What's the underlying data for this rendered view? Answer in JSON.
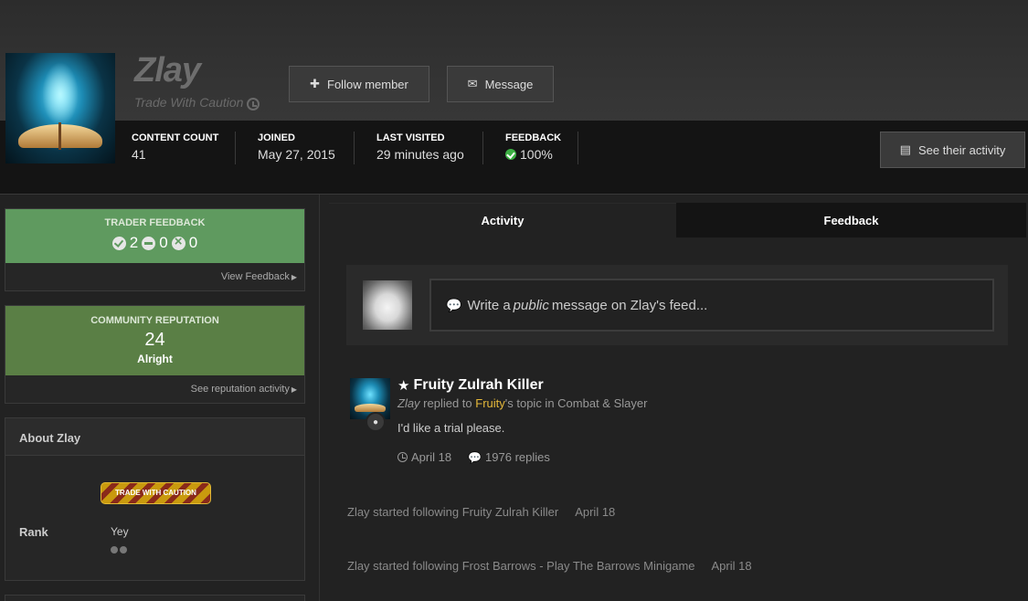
{
  "profile": {
    "username": "Zlay",
    "title": "Trade With Caution",
    "follow_label": "Follow member",
    "message_label": "Message",
    "activity_label": "See their activity",
    "stats": [
      {
        "label": "Content Count",
        "value": "41"
      },
      {
        "label": "Joined",
        "value": "May 27, 2015"
      },
      {
        "label": "Last Visited",
        "value": "29 minutes ago"
      },
      {
        "label": "Feedback",
        "value": "100%"
      }
    ]
  },
  "sidebar": {
    "trader_feedback": {
      "caption": "Trader Feedback",
      "positive": "2",
      "neutral": "0",
      "negative": "0",
      "link": "View Feedback"
    },
    "reputation": {
      "caption": "Community Reputation",
      "value": "24",
      "level": "Alright",
      "link": "See reputation activity"
    },
    "about": {
      "heading": "About Zlay",
      "badge_text": "TRADE WITH CAUTION",
      "rank_label": "Rank",
      "rank_value": "Yey"
    }
  },
  "tabs": [
    {
      "label": "Activity",
      "active": true
    },
    {
      "label": "Feedback",
      "active": false
    }
  ],
  "status": {
    "prefix": "Write a ",
    "emphasis": "public",
    "suffix": " message on Zlay's feed..."
  },
  "post": {
    "title": "Fruity Zulrah Killer",
    "author": "Zlay",
    "replied_text": " replied to ",
    "target_user": "Fruity",
    "topic_suffix": "'s topic in Combat & Slayer",
    "body": "I'd like a trial please.",
    "date": "April 18",
    "replies": "1976 replies"
  },
  "stream": [
    {
      "text": "Zlay started following Fruity Zulrah Killer",
      "date": "April 18"
    },
    {
      "text": "Zlay started following Frost Barrows - Play The Barrows Minigame",
      "date": "April 18"
    }
  ],
  "colors": {
    "feedback_green": "#5f9a5f",
    "reputation_green": "#5a7f45",
    "highlight_gold": "#e5b83a",
    "success": "#3cb043"
  }
}
